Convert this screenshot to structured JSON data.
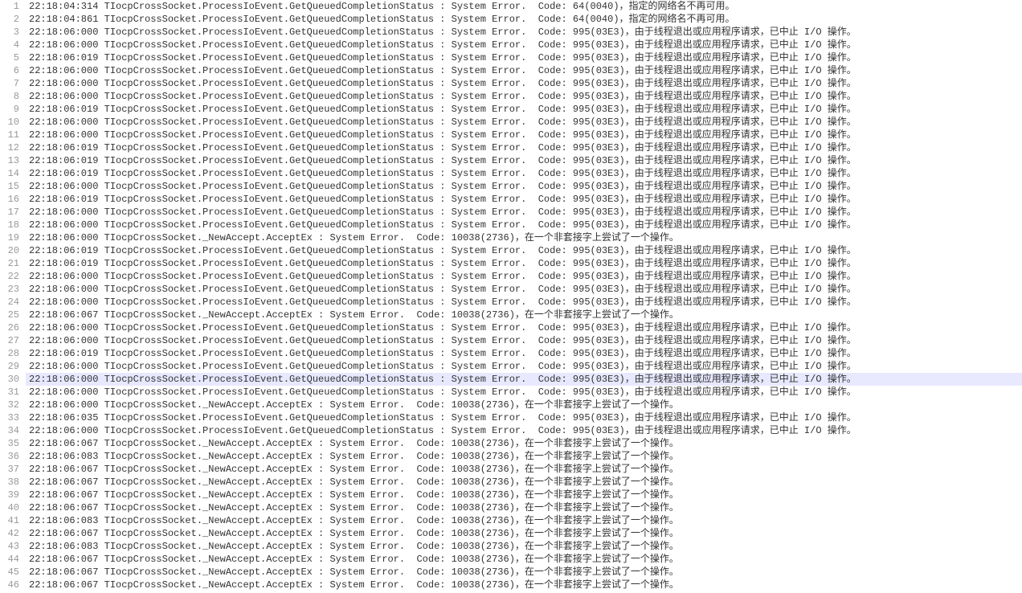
{
  "highlighted_line_index": 29,
  "log_lines": [
    "22:18:04:314 TIocpCrossSocket.ProcessIoEvent.GetQueuedCompletionStatus : System Error.  Code: 64(0040)，指定的网络名不再可用。",
    "22:18:04:861 TIocpCrossSocket.ProcessIoEvent.GetQueuedCompletionStatus : System Error.  Code: 64(0040)，指定的网络名不再可用。",
    "22:18:06:000 TIocpCrossSocket.ProcessIoEvent.GetQueuedCompletionStatus : System Error.  Code: 995(03E3)，由于线程退出或应用程序请求，已中止 I/O 操作。",
    "22:18:06:000 TIocpCrossSocket.ProcessIoEvent.GetQueuedCompletionStatus : System Error.  Code: 995(03E3)，由于线程退出或应用程序请求，已中止 I/O 操作。",
    "22:18:06:019 TIocpCrossSocket.ProcessIoEvent.GetQueuedCompletionStatus : System Error.  Code: 995(03E3)，由于线程退出或应用程序请求，已中止 I/O 操作。",
    "22:18:06:000 TIocpCrossSocket.ProcessIoEvent.GetQueuedCompletionStatus : System Error.  Code: 995(03E3)，由于线程退出或应用程序请求，已中止 I/O 操作。",
    "22:18:06:000 TIocpCrossSocket.ProcessIoEvent.GetQueuedCompletionStatus : System Error.  Code: 995(03E3)，由于线程退出或应用程序请求，已中止 I/O 操作。",
    "22:18:06:000 TIocpCrossSocket.ProcessIoEvent.GetQueuedCompletionStatus : System Error.  Code: 995(03E3)，由于线程退出或应用程序请求，已中止 I/O 操作。",
    "22:18:06:019 TIocpCrossSocket.ProcessIoEvent.GetQueuedCompletionStatus : System Error.  Code: 995(03E3)，由于线程退出或应用程序请求，已中止 I/O 操作。",
    "22:18:06:000 TIocpCrossSocket.ProcessIoEvent.GetQueuedCompletionStatus : System Error.  Code: 995(03E3)，由于线程退出或应用程序请求，已中止 I/O 操作。",
    "22:18:06:000 TIocpCrossSocket.ProcessIoEvent.GetQueuedCompletionStatus : System Error.  Code: 995(03E3)，由于线程退出或应用程序请求，已中止 I/O 操作。",
    "22:18:06:019 TIocpCrossSocket.ProcessIoEvent.GetQueuedCompletionStatus : System Error.  Code: 995(03E3)，由于线程退出或应用程序请求，已中止 I/O 操作。",
    "22:18:06:019 TIocpCrossSocket.ProcessIoEvent.GetQueuedCompletionStatus : System Error.  Code: 995(03E3)，由于线程退出或应用程序请求，已中止 I/O 操作。",
    "22:18:06:019 TIocpCrossSocket.ProcessIoEvent.GetQueuedCompletionStatus : System Error.  Code: 995(03E3)，由于线程退出或应用程序请求，已中止 I/O 操作。",
    "22:18:06:000 TIocpCrossSocket.ProcessIoEvent.GetQueuedCompletionStatus : System Error.  Code: 995(03E3)，由于线程退出或应用程序请求，已中止 I/O 操作。",
    "22:18:06:019 TIocpCrossSocket.ProcessIoEvent.GetQueuedCompletionStatus : System Error.  Code: 995(03E3)，由于线程退出或应用程序请求，已中止 I/O 操作。",
    "22:18:06:000 TIocpCrossSocket.ProcessIoEvent.GetQueuedCompletionStatus : System Error.  Code: 995(03E3)，由于线程退出或应用程序请求，已中止 I/O 操作。",
    "22:18:06:000 TIocpCrossSocket.ProcessIoEvent.GetQueuedCompletionStatus : System Error.  Code: 995(03E3)，由于线程退出或应用程序请求，已中止 I/O 操作。",
    "22:18:06:000 TIocpCrossSocket._NewAccept.AcceptEx : System Error.  Code: 10038(2736)，在一个非套接字上尝试了一个操作。",
    "22:18:06:019 TIocpCrossSocket.ProcessIoEvent.GetQueuedCompletionStatus : System Error.  Code: 995(03E3)，由于线程退出或应用程序请求，已中止 I/O 操作。",
    "22:18:06:019 TIocpCrossSocket.ProcessIoEvent.GetQueuedCompletionStatus : System Error.  Code: 995(03E3)，由于线程退出或应用程序请求，已中止 I/O 操作。",
    "22:18:06:000 TIocpCrossSocket.ProcessIoEvent.GetQueuedCompletionStatus : System Error.  Code: 995(03E3)，由于线程退出或应用程序请求，已中止 I/O 操作。",
    "22:18:06:000 TIocpCrossSocket.ProcessIoEvent.GetQueuedCompletionStatus : System Error.  Code: 995(03E3)，由于线程退出或应用程序请求，已中止 I/O 操作。",
    "22:18:06:000 TIocpCrossSocket.ProcessIoEvent.GetQueuedCompletionStatus : System Error.  Code: 995(03E3)，由于线程退出或应用程序请求，已中止 I/O 操作。",
    "22:18:06:067 TIocpCrossSocket._NewAccept.AcceptEx : System Error.  Code: 10038(2736)，在一个非套接字上尝试了一个操作。",
    "22:18:06:000 TIocpCrossSocket.ProcessIoEvent.GetQueuedCompletionStatus : System Error.  Code: 995(03E3)，由于线程退出或应用程序请求，已中止 I/O 操作。",
    "22:18:06:000 TIocpCrossSocket.ProcessIoEvent.GetQueuedCompletionStatus : System Error.  Code: 995(03E3)，由于线程退出或应用程序请求，已中止 I/O 操作。",
    "22:18:06:019 TIocpCrossSocket.ProcessIoEvent.GetQueuedCompletionStatus : System Error.  Code: 995(03E3)，由于线程退出或应用程序请求，已中止 I/O 操作。",
    "22:18:06:000 TIocpCrossSocket.ProcessIoEvent.GetQueuedCompletionStatus : System Error.  Code: 995(03E3)，由于线程退出或应用程序请求，已中止 I/O 操作。",
    "22:18:06:000 TIocpCrossSocket.ProcessIoEvent.GetQueuedCompletionStatus : System Error.  Code: 995(03E3)，由于线程退出或应用程序请求，已中止 I/O 操作。",
    "22:18:06:000 TIocpCrossSocket.ProcessIoEvent.GetQueuedCompletionStatus : System Error.  Code: 995(03E3)，由于线程退出或应用程序请求，已中止 I/O 操作。",
    "22:18:06:000 TIocpCrossSocket._NewAccept.AcceptEx : System Error.  Code: 10038(2736)，在一个非套接字上尝试了一个操作。",
    "22:18:06:035 TIocpCrossSocket.ProcessIoEvent.GetQueuedCompletionStatus : System Error.  Code: 995(03E3)，由于线程退出或应用程序请求，已中止 I/O 操作。",
    "22:18:06:000 TIocpCrossSocket.ProcessIoEvent.GetQueuedCompletionStatus : System Error.  Code: 995(03E3)，由于线程退出或应用程序请求，已中止 I/O 操作。",
    "22:18:06:067 TIocpCrossSocket._NewAccept.AcceptEx : System Error.  Code: 10038(2736)，在一个非套接字上尝试了一个操作。",
    "22:18:06:083 TIocpCrossSocket._NewAccept.AcceptEx : System Error.  Code: 10038(2736)，在一个非套接字上尝试了一个操作。",
    "22:18:06:067 TIocpCrossSocket._NewAccept.AcceptEx : System Error.  Code: 10038(2736)，在一个非套接字上尝试了一个操作。",
    "22:18:06:067 TIocpCrossSocket._NewAccept.AcceptEx : System Error.  Code: 10038(2736)，在一个非套接字上尝试了一个操作。",
    "22:18:06:067 TIocpCrossSocket._NewAccept.AcceptEx : System Error.  Code: 10038(2736)，在一个非套接字上尝试了一个操作。",
    "22:18:06:067 TIocpCrossSocket._NewAccept.AcceptEx : System Error.  Code: 10038(2736)，在一个非套接字上尝试了一个操作。",
    "22:18:06:083 TIocpCrossSocket._NewAccept.AcceptEx : System Error.  Code: 10038(2736)，在一个非套接字上尝试了一个操作。",
    "22:18:06:067 TIocpCrossSocket._NewAccept.AcceptEx : System Error.  Code: 10038(2736)，在一个非套接字上尝试了一个操作。",
    "22:18:06:083 TIocpCrossSocket._NewAccept.AcceptEx : System Error.  Code: 10038(2736)，在一个非套接字上尝试了一个操作。",
    "22:18:06:067 TIocpCrossSocket._NewAccept.AcceptEx : System Error.  Code: 10038(2736)，在一个非套接字上尝试了一个操作。",
    "22:18:06:067 TIocpCrossSocket._NewAccept.AcceptEx : System Error.  Code: 10038(2736)，在一个非套接字上尝试了一个操作。",
    "22:18:06:067 TIocpCrossSocket._NewAccept.AcceptEx : System Error.  Code: 10038(2736)，在一个非套接字上尝试了一个操作。"
  ]
}
